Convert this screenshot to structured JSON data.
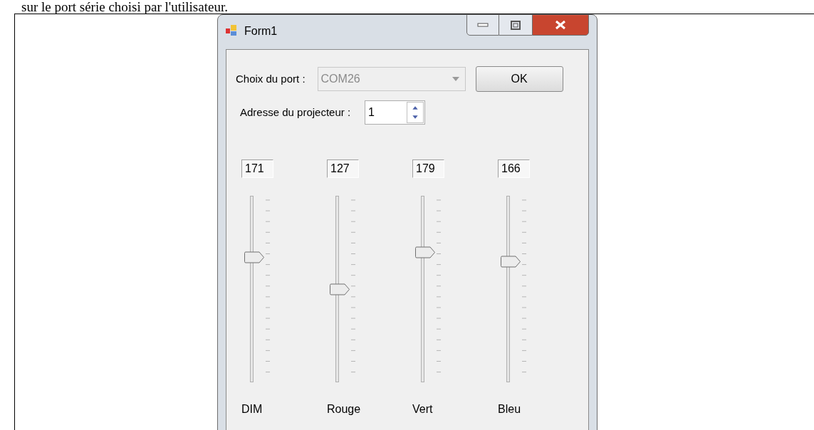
{
  "document_text": "sur le port série choisi par l'utilisateur.",
  "window": {
    "title": "Form1"
  },
  "port": {
    "label": "Choix du port :",
    "value": "COM26",
    "disabled": true
  },
  "ok_button": "OK",
  "address": {
    "label": "Adresse du projecteur :",
    "value": "1"
  },
  "sliders": [
    {
      "name": "DIM",
      "reading": "171",
      "level": 0.67
    },
    {
      "name": "Rouge",
      "reading": "127",
      "level": 0.5
    },
    {
      "name": "Vert",
      "reading": "179",
      "level": 0.7
    },
    {
      "name": "Bleu",
      "reading": "166",
      "level": 0.65
    }
  ]
}
